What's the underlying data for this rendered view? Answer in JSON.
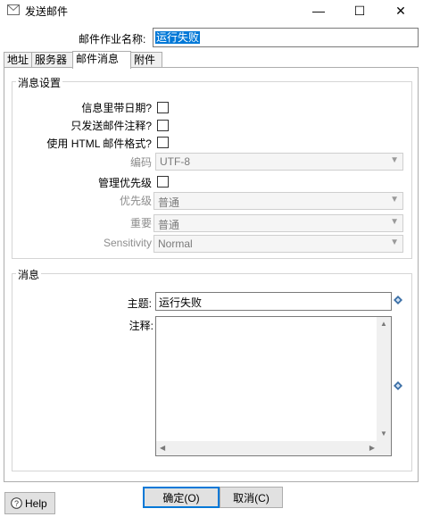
{
  "window": {
    "title": "发送邮件",
    "minimize": "—",
    "maximize": "☐",
    "close": "✕"
  },
  "job_name": {
    "label": "邮件作业名称:",
    "value": "运行失败"
  },
  "tabs": [
    {
      "label": "地址"
    },
    {
      "label": "服务器"
    },
    {
      "label": "邮件消息"
    },
    {
      "label": "附件"
    }
  ],
  "settings": {
    "title": "消息设置",
    "include_date_label": "信息里带日期?",
    "only_comment_label": "只发送邮件注释?",
    "html_format_label": "使用 HTML 邮件格式?",
    "encoding_label": "编码",
    "encoding_value": "UTF-8",
    "manage_priority_label": "管理优先级",
    "priority_label": "优先级",
    "priority_value": "普通",
    "importance_label": "重要",
    "importance_value": "普通",
    "sensitivity_label": "Sensitivity",
    "sensitivity_value": "Normal"
  },
  "message": {
    "title": "消息",
    "subject_label": "主题:",
    "subject_value": "运行失败",
    "comment_label": "注释:",
    "comment_value": ""
  },
  "buttons": {
    "help": "Help",
    "ok": "确定(O)",
    "cancel": "取消(C)"
  },
  "colors": {
    "selection": "#0078d7",
    "variable_icon": "#3a6ea5"
  },
  "icons": {
    "title": "mail-icon",
    "help": "help-icon",
    "variable": "variable-diamond-icon"
  }
}
